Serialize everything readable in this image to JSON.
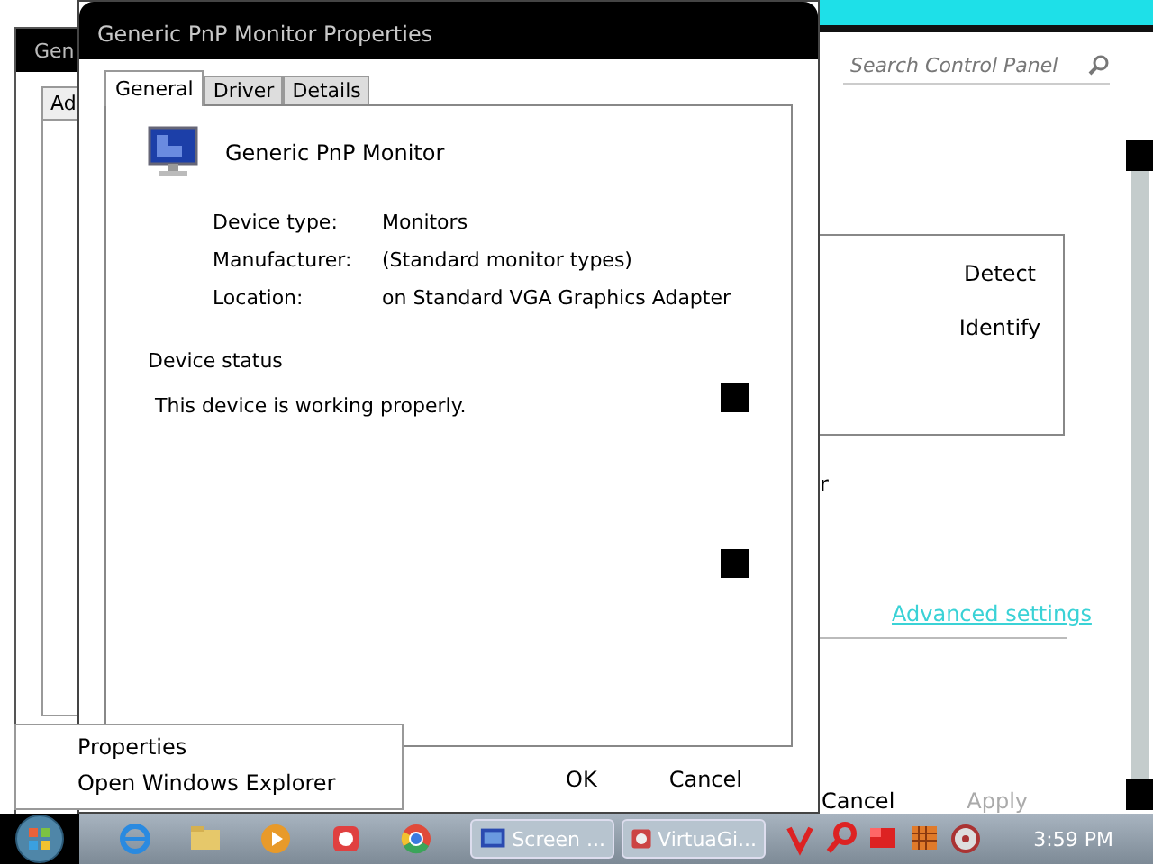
{
  "control_panel": {
    "search": {
      "placeholder": "Search Control Panel"
    },
    "buttons": [
      {
        "label": "Detect"
      },
      {
        "label": "Identify"
      }
    ],
    "cut_text": "r",
    "link": "Advanced settings",
    "footer_buttons": [
      {
        "label": "Cancel",
        "disabled": false
      },
      {
        "label": "Apply",
        "disabled": true
      }
    ]
  },
  "back_dialog": {
    "title": "Gen",
    "tab": "Ad"
  },
  "dialog": {
    "title": "Generic PnP Monitor Properties",
    "tabs": [
      {
        "label": "General",
        "selected": true
      },
      {
        "label": "Driver",
        "selected": false
      },
      {
        "label": "Details",
        "selected": false
      }
    ],
    "device_name": "Generic PnP Monitor",
    "properties": [
      {
        "label": "Device type:",
        "value": "Monitors"
      },
      {
        "label": "Manufacturer:",
        "value": "(Standard monitor types)"
      },
      {
        "label": "Location:",
        "value": "on Standard VGA Graphics Adapter"
      }
    ],
    "status_title": "Device status",
    "status_text": "This device is working properly.",
    "buttons": [
      "OK",
      "Cancel"
    ]
  },
  "context_menu": [
    "Properties",
    "Open Windows Explorer"
  ],
  "taskbar": {
    "pinned": [
      {
        "kind": "ie"
      },
      {
        "kind": "folder"
      },
      {
        "kind": "media"
      },
      {
        "kind": "app"
      },
      {
        "kind": "chrome"
      }
    ],
    "tasks": [
      {
        "label": "Screen ...",
        "kind": "screen"
      },
      {
        "label": "VirtuaGi...",
        "kind": "app"
      }
    ],
    "tray": [
      {
        "kind": "v"
      },
      {
        "kind": "magnifier"
      },
      {
        "kind": "card"
      },
      {
        "kind": "grid"
      },
      {
        "kind": "disc"
      }
    ],
    "clock": "3:59 PM"
  }
}
